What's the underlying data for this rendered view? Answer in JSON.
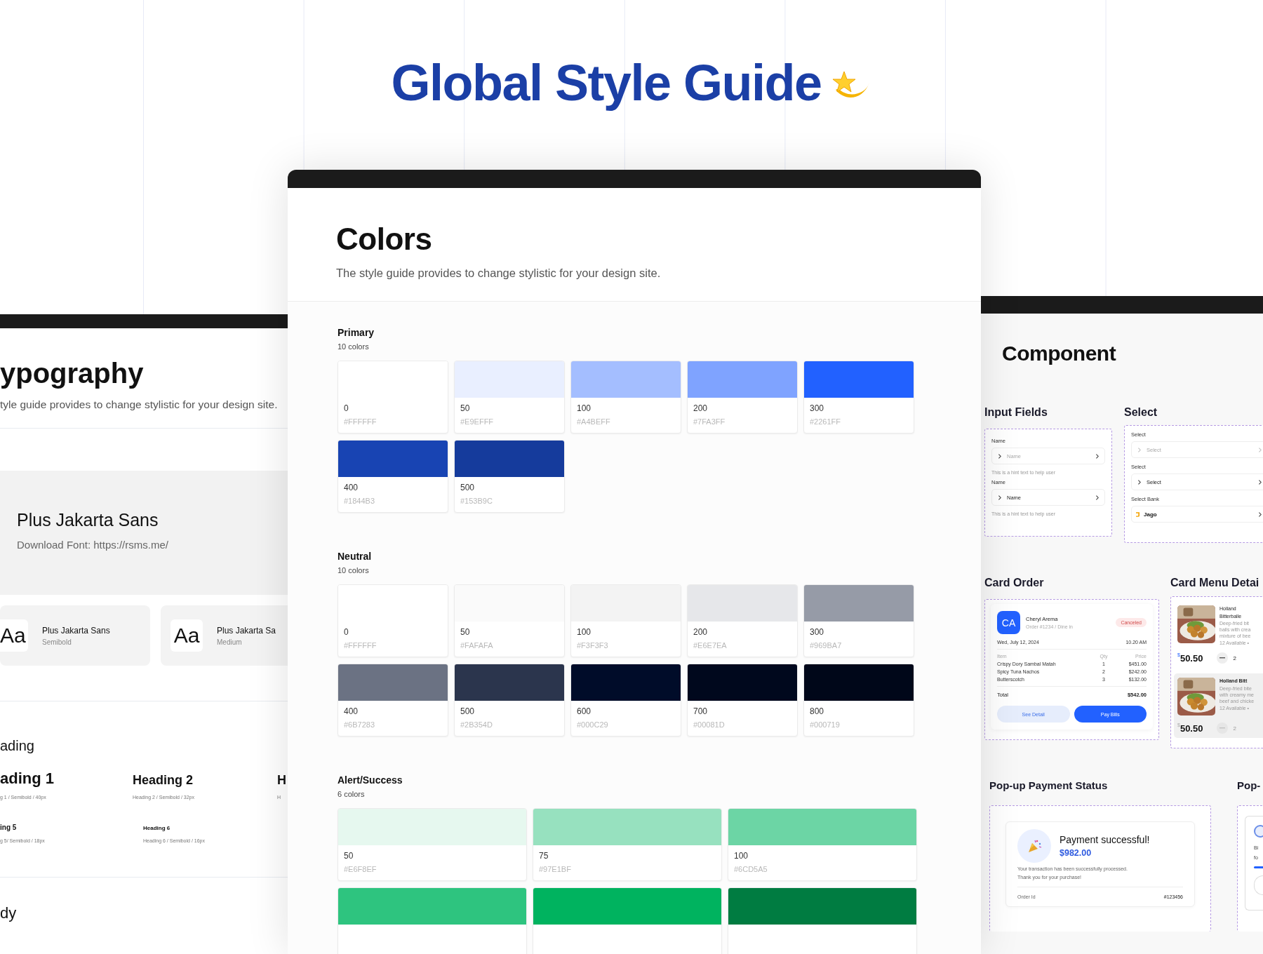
{
  "title": "Global Style Guide",
  "typography_panel": {
    "heading": "ypography",
    "subtitle": "tyle guide provides to change stylistic for your design site.",
    "font_box": {
      "name": "Plus Jakarta Sans",
      "download": "Download Font: https://rsms.me/"
    },
    "font_cards": [
      {
        "sample": "Aa",
        "name": "Plus Jakarta Sans",
        "weight": "Semibold"
      },
      {
        "sample": "Aa",
        "name": "Plus Jakarta Sa",
        "weight": "Medium"
      }
    ],
    "heading_section": "ading",
    "heading_rows": [
      [
        {
          "label": "ading 1",
          "spec": "g 1 / Semibold / 40px"
        },
        {
          "label": "Heading 2",
          "spec": "Heading 2 / Semibold / 32px"
        },
        {
          "label": "H",
          "spec": "H"
        }
      ],
      [
        {
          "label": "ing 5",
          "spec": "g 5/ Semibold / 18px"
        },
        {
          "label": "Heading 6",
          "spec": "Heading 6 / Semibold / 16px"
        }
      ]
    ],
    "body_section": "dy"
  },
  "colors_panel": {
    "heading": "Colors",
    "subtitle": "The style guide provides to change stylistic for your design site.",
    "groups": [
      {
        "name": "Primary",
        "count": "10 colors",
        "kind": "compact",
        "swatches": [
          {
            "label": "0",
            "hex": "#FFFFFF",
            "color": "#ffffff"
          },
          {
            "label": "50",
            "hex": "#E9EFFF",
            "color": "#e9efff"
          },
          {
            "label": "100",
            "hex": "#A4BEFF",
            "color": "#a4beff"
          },
          {
            "label": "200",
            "hex": "#7FA3FF",
            "color": "#7fa3ff"
          },
          {
            "label": "300",
            "hex": "#2261FF",
            "color": "#2261ff"
          },
          {
            "label": "400",
            "hex": "#1844B3",
            "color": "#1844b3"
          },
          {
            "label": "500",
            "hex": "#153B9C",
            "color": "#153b9c"
          }
        ]
      },
      {
        "name": "Neutral",
        "count": "10 colors",
        "kind": "compact",
        "swatches": [
          {
            "label": "0",
            "hex": "#FFFFFF",
            "color": "#ffffff"
          },
          {
            "label": "50",
            "hex": "#FAFAFA",
            "color": "#fafafa"
          },
          {
            "label": "100",
            "hex": "#F3F3F3",
            "color": "#f3f3f3"
          },
          {
            "label": "200",
            "hex": "#E6E7EA",
            "color": "#e6e7ea"
          },
          {
            "label": "300",
            "hex": "#969BA7",
            "color": "#969ba7"
          },
          {
            "label": "400",
            "hex": "#6B7283",
            "color": "#6b7283"
          },
          {
            "label": "500",
            "hex": "#2B354D",
            "color": "#2b354d"
          },
          {
            "label": "600",
            "hex": "#000C29",
            "color": "#000c29"
          },
          {
            "label": "700",
            "hex": "#00081D",
            "color": "#00081d"
          },
          {
            "label": "800",
            "hex": "#000719",
            "color": "#000719"
          }
        ]
      },
      {
        "name": "Alert/Success",
        "count": "6 colors",
        "kind": "wide",
        "swatches": [
          {
            "label": "50",
            "hex": "#E6F8EF",
            "color": "#e6f8ef"
          },
          {
            "label": "75",
            "hex": "#97E1BF",
            "color": "#97e1bf"
          },
          {
            "label": "100",
            "hex": "#6CD5A5",
            "color": "#6cd5a5"
          },
          {
            "color": "#2ec47f"
          },
          {
            "color": "#00b35f"
          },
          {
            "color": "#007c41"
          }
        ]
      }
    ]
  },
  "component_panel": {
    "heading": "Component",
    "input_fields": {
      "title": "Input Fields",
      "fields": [
        {
          "label": "Name",
          "placeholder": "Name",
          "hint": "This is a hint text to help user"
        },
        {
          "label": "Name",
          "value": "Name",
          "hint": "This is a hint text to help user"
        }
      ]
    },
    "select": {
      "title": "Select",
      "fields": [
        {
          "label": "Select",
          "placeholder": "Select",
          "kind": "plain"
        },
        {
          "label": "Select",
          "value": "Select",
          "kind": "plain"
        },
        {
          "label": "Select Bank",
          "value": "Jago",
          "kind": "bank"
        }
      ]
    },
    "card_order": {
      "title": "Card Order",
      "initials": "CA",
      "customer": "Cheryl Arema",
      "order": "Order #1234 / Dine in",
      "status": "Canceled",
      "date": "Wed, July 12, 2024",
      "time": "10.20 AM",
      "columns": [
        "Item",
        "Qty",
        "Price"
      ],
      "rows": [
        [
          "Crispy Dory Sambal Matah",
          "1",
          "$451.00"
        ],
        [
          "Spicy Tuna Nachos",
          "2",
          "$242.00"
        ],
        [
          "Butterscotch",
          "3",
          "$132.00"
        ]
      ],
      "total_label": "Total",
      "total": "$542.00",
      "buttons": [
        {
          "label": "See Detail",
          "kind": "secondary"
        },
        {
          "label": "Pay Bills",
          "kind": "primary"
        }
      ]
    },
    "card_menu": {
      "title": "Card Menu Detai",
      "items": [
        {
          "name_lines": [
            "Holland",
            "Bitterballe"
          ],
          "description_lines": [
            "Deep-fried bit",
            "balls with crea",
            "mixture of bee"
          ],
          "availability": "12 Available •",
          "currency": "$",
          "price": "50.50",
          "quantity": "2",
          "disabled": false
        },
        {
          "name_lines": [
            "Holland Bitt"
          ],
          "description_lines": [
            "Deep-fried bite",
            "with creamy me",
            "beef and chicke"
          ],
          "availability": "12 Available •",
          "currency": "$",
          "price": "50.50",
          "quantity": "2",
          "disabled": true
        }
      ]
    },
    "popup_payment": {
      "title": "Pop-up Payment Status",
      "heading": "Payment successful!",
      "amount": "$982.00",
      "message_lines": [
        "Your transaction has been successfully processed.",
        "Thank you for your purchase!"
      ],
      "detail_label": "Order Id",
      "detail_value": "#123456"
    },
    "popup_other": {
      "title": "Pop-",
      "text_lines": [
        "Bi",
        "fo"
      ]
    }
  }
}
